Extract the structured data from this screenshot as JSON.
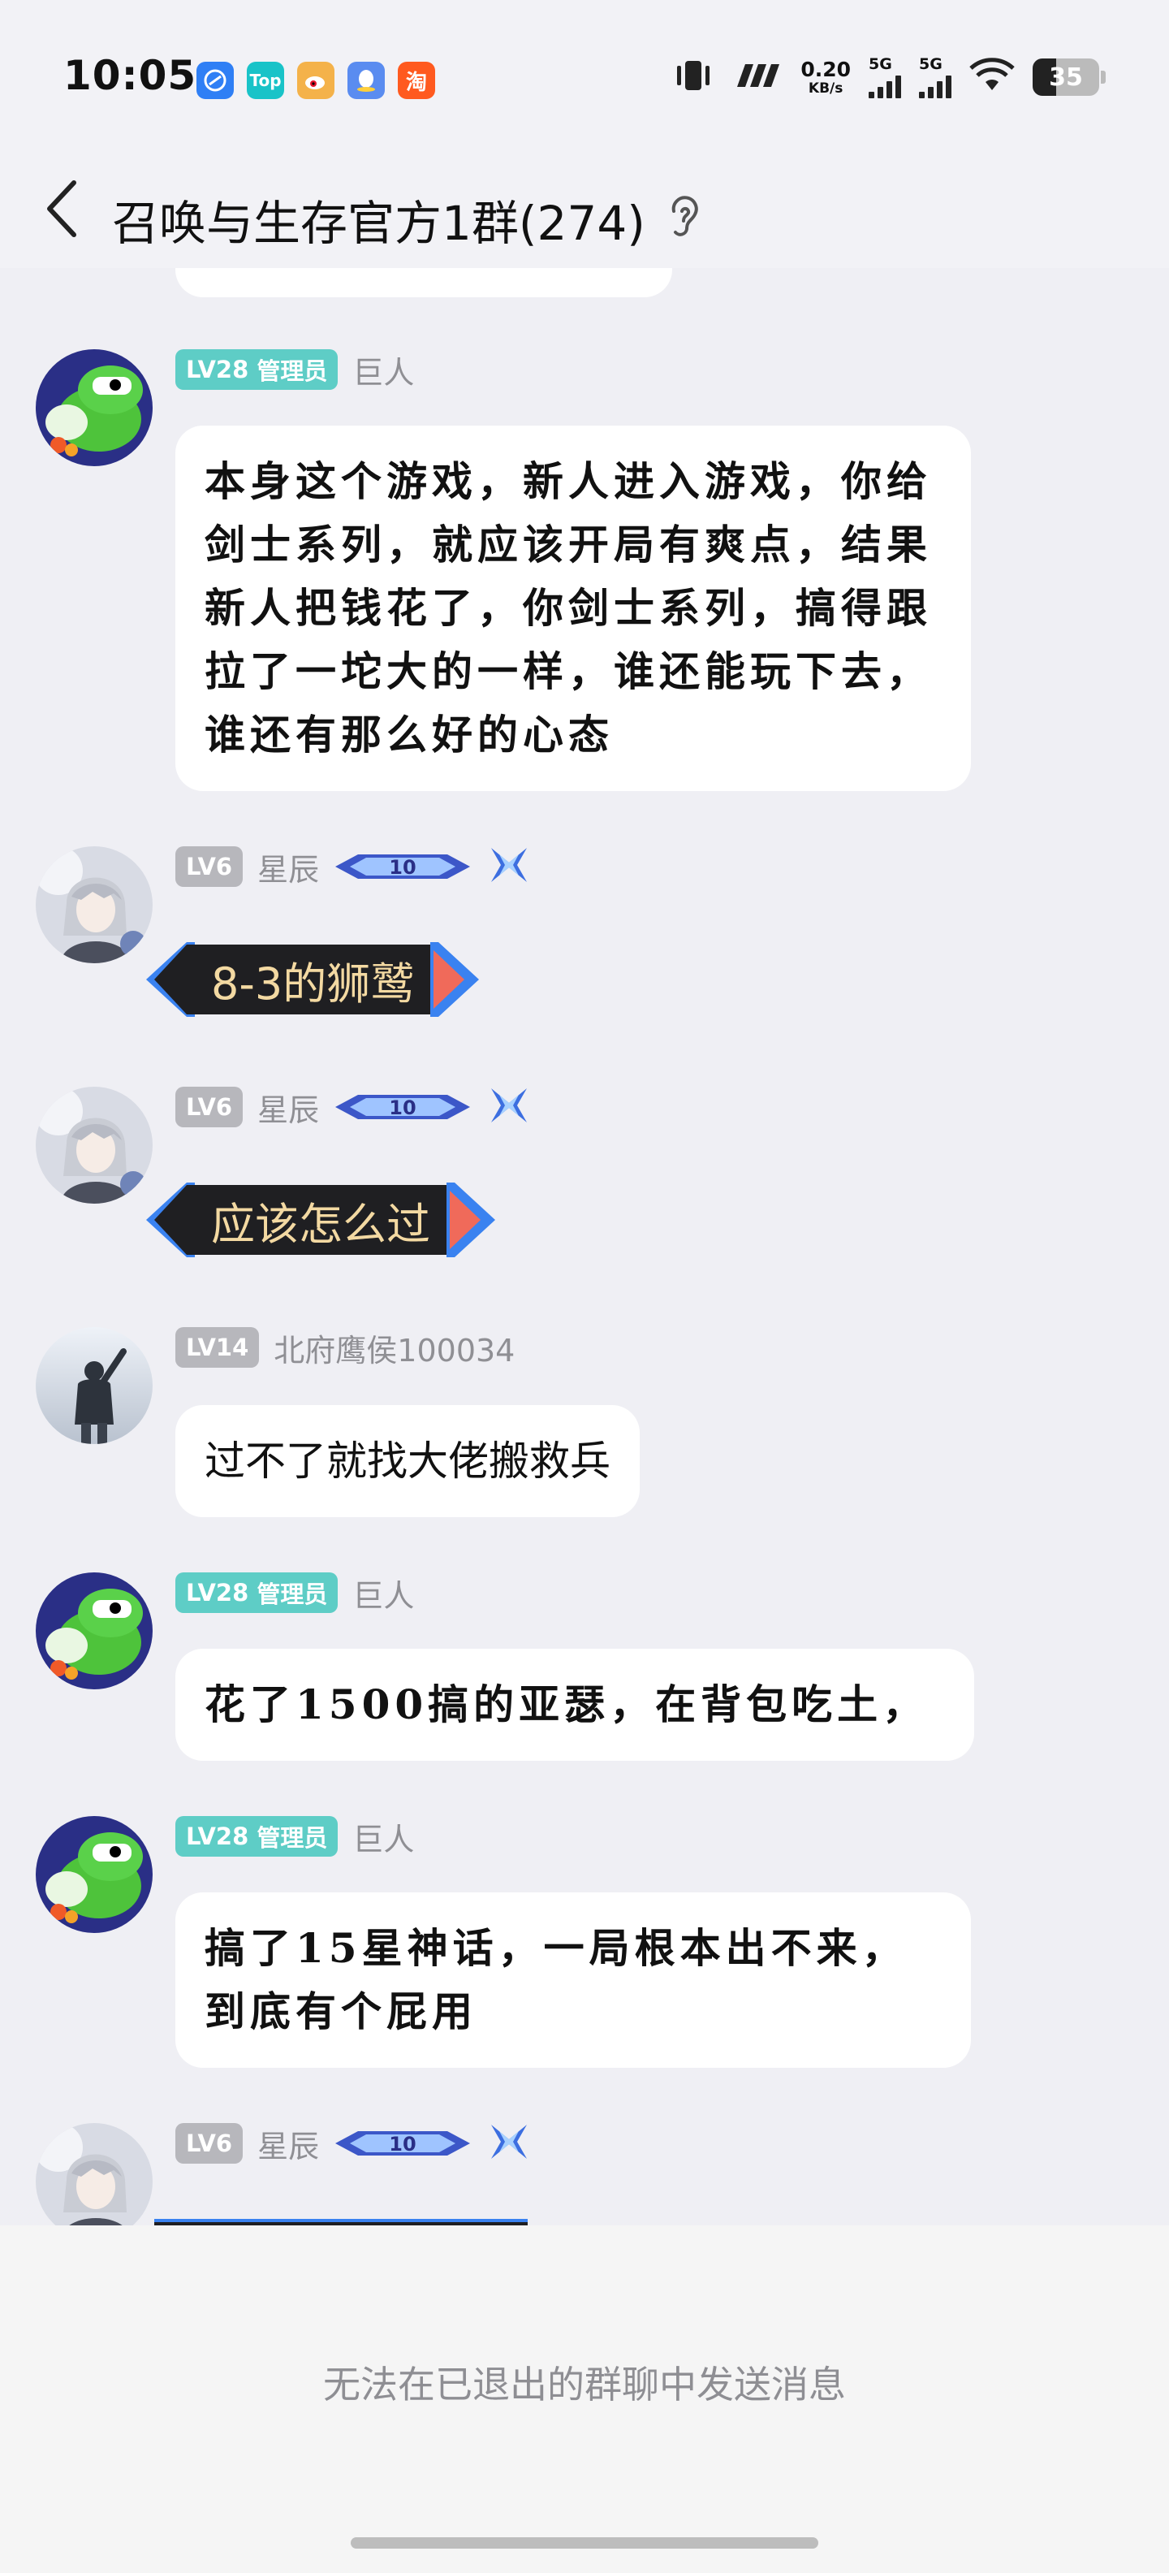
{
  "status_bar": {
    "time": "10:05",
    "apps": [
      {
        "icon": "browser-app-icon",
        "label": "",
        "color": "#2f7ff5"
      },
      {
        "icon": "toptop-app-icon",
        "label": "Top",
        "color": "#19c3c8"
      },
      {
        "icon": "weibo-app-icon",
        "label": "",
        "color": "#f4b24a"
      },
      {
        "icon": "qq-app-icon",
        "label": "",
        "color": "#5a8cf0"
      },
      {
        "icon": "taobao-app-icon",
        "label": "淘",
        "color": "#ff5a1f"
      }
    ],
    "net_speed": "0.20",
    "net_unit": "KB/s",
    "sim1": "5G",
    "sim2": "5G",
    "battery": "35"
  },
  "header": {
    "title": "召唤与生存官方1群(274)"
  },
  "colors": {
    "admin_badge": "#5ecdc6",
    "level_badge": "#b7b7bc"
  },
  "messages": [
    {
      "type": "text",
      "level": "LV28",
      "role": "管理员",
      "name": "巨人",
      "avatar": "green-dino-avatar",
      "text": "本身这个游戏，新人进入游戏，你给剑士系列，就应该开局有爽点，结果新人把钱花了，你剑士系列，搞得跟拉了一坨大的一样，谁还能玩下去，谁还有那么好的心态"
    },
    {
      "type": "banner",
      "level": "LV6",
      "name": "星辰",
      "avatar": "anime-boy-avatar",
      "badge_number": "10",
      "text": "8-3的狮鹫"
    },
    {
      "type": "banner",
      "level": "LV6",
      "name": "星辰",
      "avatar": "anime-boy-avatar",
      "badge_number": "10",
      "text": "应该怎么过"
    },
    {
      "type": "text",
      "level": "LV14",
      "name": "北府鹰侯100034",
      "avatar": "man-backview-avatar",
      "text": "过不了就找大佬搬救兵"
    },
    {
      "type": "text",
      "level": "LV28",
      "role": "管理员",
      "name": "巨人",
      "avatar": "green-dino-avatar",
      "text": "花了1500搞的亚瑟，在背包吃土，"
    },
    {
      "type": "text",
      "level": "LV28",
      "role": "管理员",
      "name": "巨人",
      "avatar": "green-dino-avatar",
      "text": "搞了15星神话，一局根本出不来，到底有个屁用"
    },
    {
      "type": "banner",
      "level": "LV6",
      "name": "星辰",
      "avatar": "anime-boy-avatar",
      "badge_number": "10",
      "text": ""
    }
  ],
  "footer": {
    "notice": "无法在已退出的群聊中发送消息"
  }
}
